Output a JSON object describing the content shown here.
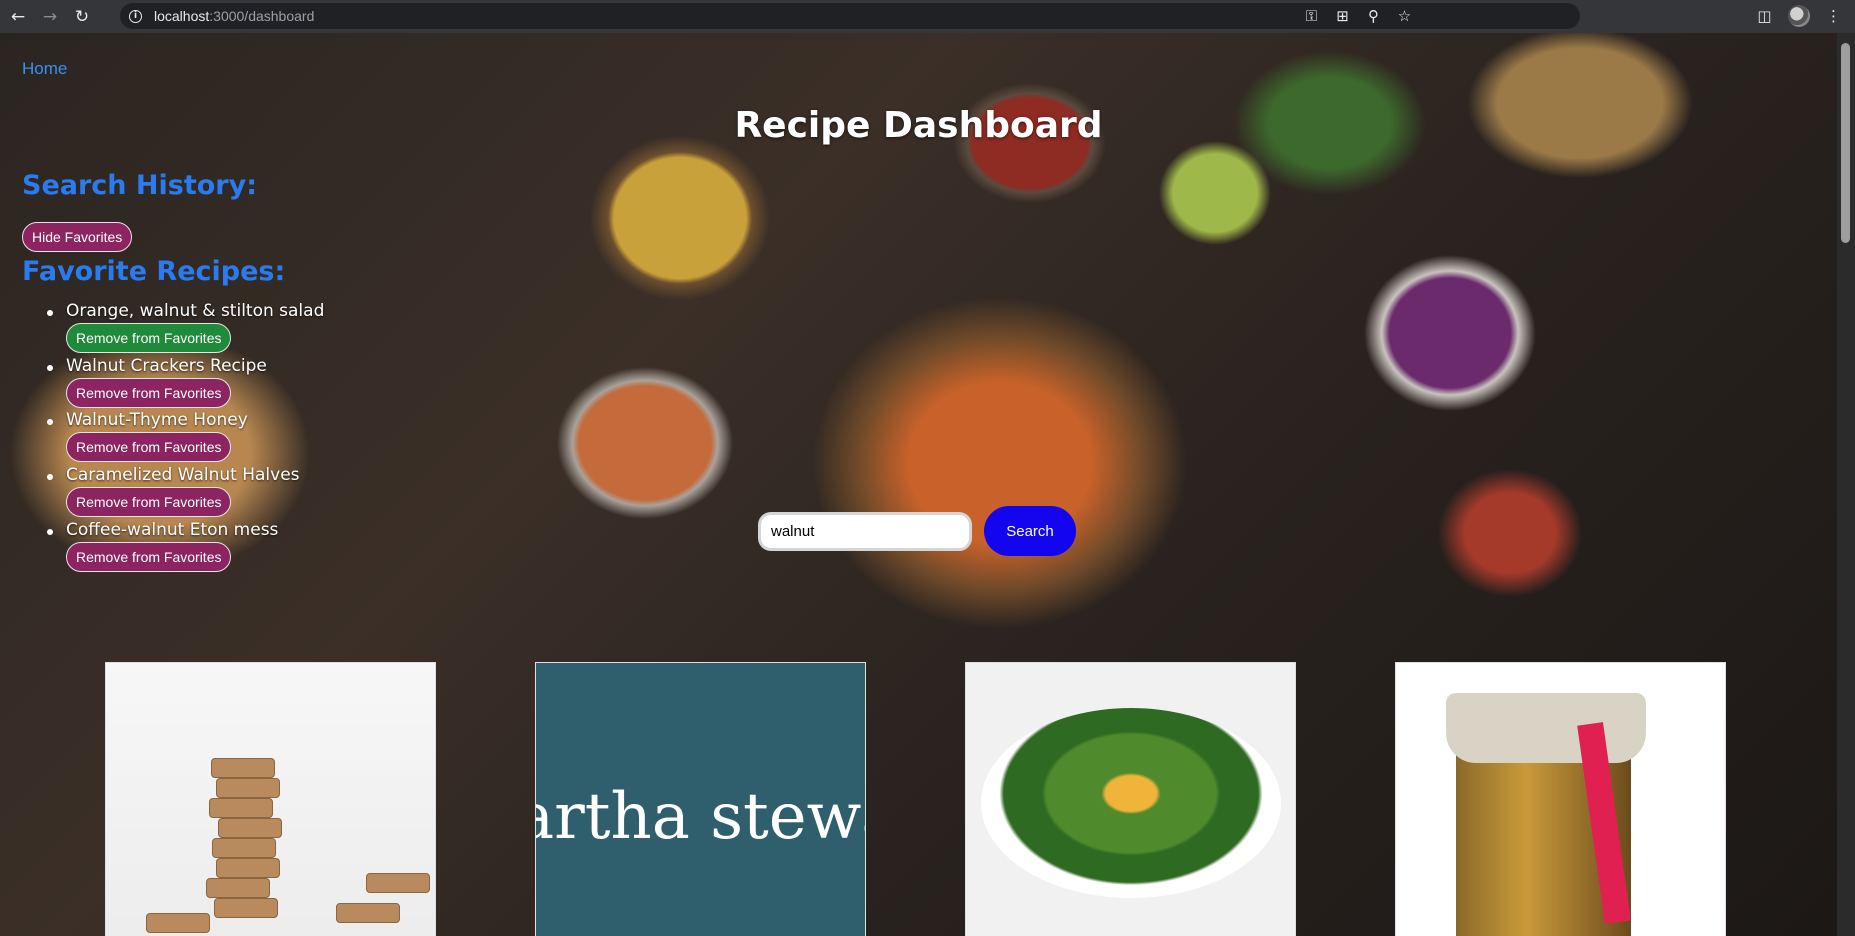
{
  "browser": {
    "url_host": "localhost",
    "url_path": ":3000/dashboard",
    "icons": [
      "back-icon",
      "forward-icon",
      "reload-icon",
      "info-icon",
      "key-icon",
      "install-icon",
      "zoom-icon",
      "star-icon",
      "sidepanel-icon",
      "profile-avatar",
      "menu-icon"
    ]
  },
  "nav": {
    "home_label": "Home"
  },
  "page": {
    "title": "Recipe Dashboard"
  },
  "history": {
    "heading": "Search History:"
  },
  "favorites": {
    "toggle_label": "Hide Favorites",
    "heading": "Favorite Recipes:",
    "remove_label": "Remove from Favorites",
    "items": [
      {
        "name": "Orange, walnut & stilton salad"
      },
      {
        "name": "Walnut Crackers Recipe"
      },
      {
        "name": "Walnut-Thyme Honey"
      },
      {
        "name": "Caramelized Walnut Halves"
      },
      {
        "name": "Coffee-walnut Eton mess"
      }
    ]
  },
  "search": {
    "value": "walnut",
    "button_label": "Search"
  },
  "results": {
    "cards": [
      {
        "image": "walnut-crackers-photo"
      },
      {
        "image": "martha-stewart-logo",
        "logo_text": "artha stewa"
      },
      {
        "image": "salad-photo"
      },
      {
        "image": "honey-jar-photo"
      }
    ]
  },
  "colors": {
    "link": "#3c8ef3",
    "heading": "#2a7bf0",
    "pill_button": "#8b2461",
    "pill_button_active": "#1e8a3a",
    "search_button": "#1405ef"
  }
}
